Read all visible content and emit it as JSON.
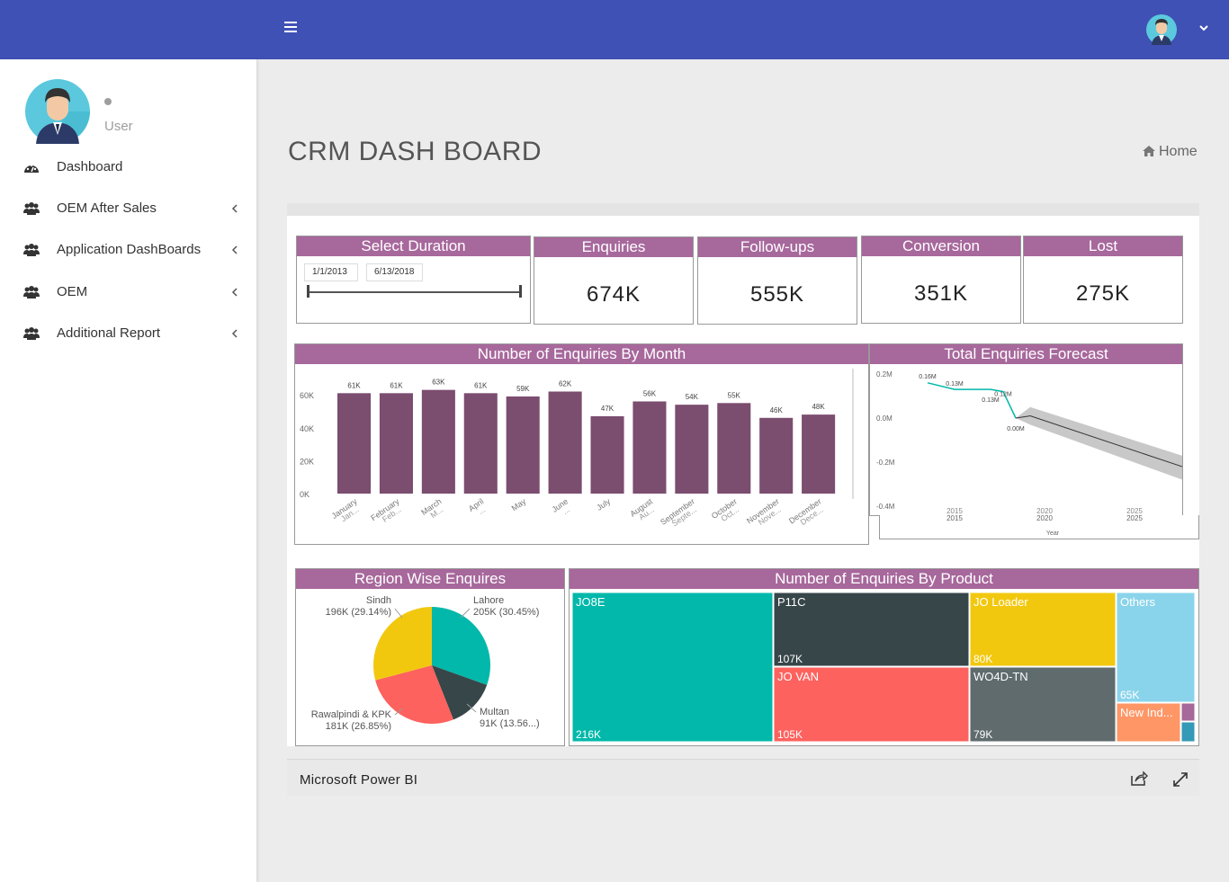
{
  "header": {
    "menu_icon": "hamburger-icon",
    "caret_icon": "chevron-down-icon"
  },
  "sidebar": {
    "user_label": "User",
    "items": [
      {
        "label": "Dashboard",
        "icon": "dashboard-icon"
      },
      {
        "label": "OEM After Sales",
        "icon": "users-icon"
      },
      {
        "label": "Application DashBoards",
        "icon": "users-icon"
      },
      {
        "label": "OEM",
        "icon": "users-icon"
      },
      {
        "label": "Additional Report",
        "icon": "users-icon"
      }
    ]
  },
  "page": {
    "title": "CRM DASH BOARD",
    "breadcrumb": "Home"
  },
  "duration": {
    "title": "Select Duration",
    "start": "1/1/2013",
    "end": "6/13/2018"
  },
  "kpis": [
    {
      "title": "Enquiries",
      "value": "674K"
    },
    {
      "title": "Follow-ups",
      "value": "555K"
    },
    {
      "title": "Conversion",
      "value": "351K"
    },
    {
      "title": "Lost",
      "value": "275K"
    }
  ],
  "colors": {
    "topbar": "#3f51b5",
    "tile_header": "#a7689c",
    "bar": "#7b4d6f",
    "teal": "#01b8aa",
    "dark": "#374649",
    "red": "#fd625e",
    "yellow": "#f2c80f",
    "gray": "#5f6b6d",
    "lightblue": "#8ad4eb",
    "orange": "#fe9666",
    "purple": "#a66999",
    "blue": "#3599b8"
  },
  "chart_data": [
    {
      "type": "bar",
      "title": "Number of Enquiries By Month",
      "categories": [
        "January",
        "February",
        "March",
        "April",
        "May",
        "June",
        "July",
        "August",
        "September",
        "October",
        "November",
        "December"
      ],
      "category_sublabels": [
        "Jan...",
        "Feb...",
        "M...",
        "...",
        "",
        "...",
        "",
        "Au...",
        "Septe...",
        "Oct...",
        "Nove...",
        "Dece..."
      ],
      "values": [
        61,
        61,
        63,
        61,
        59,
        62,
        47,
        56,
        54,
        55,
        46,
        48
      ],
      "data_labels": [
        "61K",
        "61K",
        "63K",
        "61K",
        "59K",
        "62K",
        "47K",
        "56K",
        "54K",
        "55K",
        "46K",
        "48K"
      ],
      "yticks": [
        "0K",
        "20K",
        "40K",
        "60K"
      ],
      "ylim": [
        0,
        65
      ],
      "grid": false
    },
    {
      "type": "line",
      "title": "Total Enquiries Forecast",
      "xlabel": "Year",
      "xticks": [
        "2015",
        "2020",
        "2025"
      ],
      "yticks": [
        "0.2M",
        "0.0M",
        "-0.2M",
        "-0.4M"
      ],
      "ylim": [
        -0.4,
        0.2
      ],
      "series": [
        {
          "x": [
            2013.5,
            2015,
            2017,
            2017.7,
            2018.4
          ],
          "values": [
            0.16,
            0.13,
            0.13,
            0.12,
            0.0
          ]
        },
        {
          "x": [
            2018.4,
            2019.2,
            2028
          ],
          "values": [
            0.0,
            0.01,
            -0.23
          ]
        }
      ],
      "data_labels": [
        "0.16M",
        "0.13M",
        "0.13M",
        "0.12M",
        "0.00M"
      ]
    },
    {
      "type": "pie",
      "title": "Region Wise Enquires",
      "categories": [
        "Lahore",
        "Multan",
        "Rawalpindi & KPK",
        "Sindh"
      ],
      "values": [
        205,
        91,
        181,
        196
      ],
      "data_labels": [
        "205K (30.45%)",
        "91K (13.56...)",
        "181K (26.85%)",
        "196K (29.14%)"
      ]
    },
    {
      "type": "treemap",
      "title": "Number of Enquiries By Product",
      "categories": [
        "JO8E",
        "P11C",
        "JO VAN",
        "JO Loader",
        "WO4D-TN",
        "Others",
        "New Ind..."
      ],
      "values": [
        216,
        107,
        105,
        80,
        79,
        65,
        null
      ],
      "data_labels": [
        "216K",
        "107K",
        "105K",
        "80K",
        "79K",
        "65K",
        ""
      ]
    }
  ],
  "footer": {
    "label": "Microsoft Power BI"
  }
}
